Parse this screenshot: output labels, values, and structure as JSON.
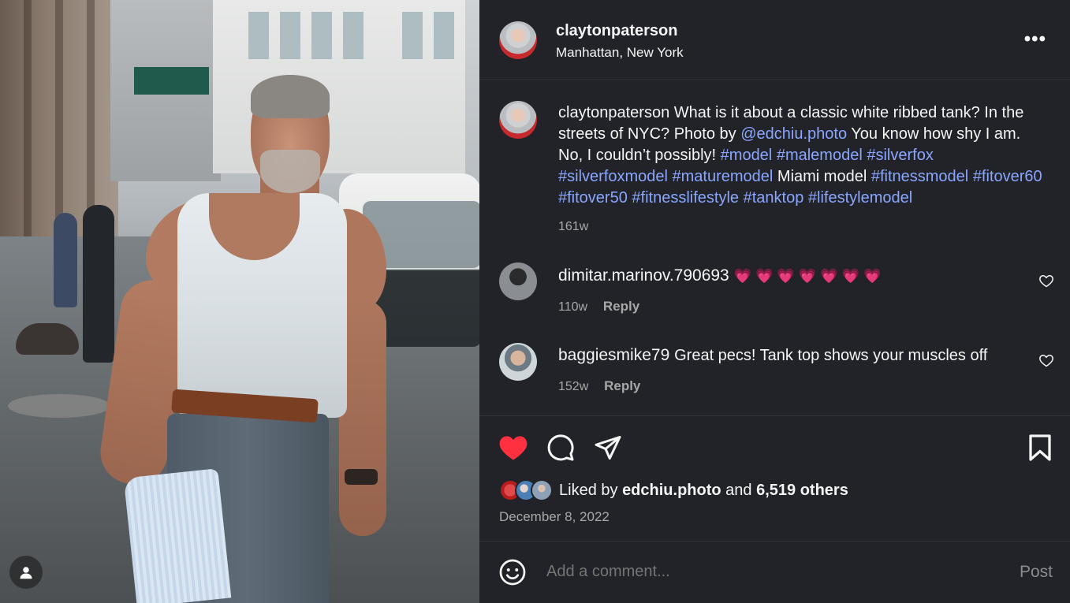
{
  "post": {
    "username": "claytonpaterson",
    "location": "Manhattan, New York",
    "more_label": "•••",
    "caption": {
      "username": "claytonpaterson",
      "text_1": " What is it about a classic white ribbed tank? In the streets of NYC? Photo by ",
      "mention": "@edchiu.photo",
      "text_2": " You know how shy I am. No, I couldn’t possibly! ",
      "tags_1": [
        "#model",
        "#malemodel",
        "#silverfox",
        "#silverfoxmodel",
        "#maturemodel"
      ],
      "text_3": " Miami model ",
      "tags_2": [
        "#fitnessmodel",
        "#fitover60",
        "#fitover50",
        "#fitnesslifestyle",
        "#tanktop",
        "#lifestylemodel"
      ],
      "time": "161w"
    },
    "comments": [
      {
        "username": "dimitar.marinov.790693",
        "text": "💗 💗 💗 💗 💗 💗 💗",
        "time": "110w",
        "reply_label": "Reply"
      },
      {
        "username": "baggiesmike79",
        "text": "Great pecs! Tank top shows your muscles off",
        "time": "152w",
        "reply_label": "Reply"
      }
    ],
    "likes": {
      "prefix": "Liked by",
      "user": "edchiu.photo",
      "and": "and",
      "others": "6,519 others"
    },
    "date": "December 8, 2022",
    "add_comment": {
      "placeholder": "Add a comment...",
      "post_label": "Post"
    }
  },
  "colors": {
    "panel_bg": "#212328",
    "link": "#8aa6ff",
    "like_red": "#ff3040",
    "muted": "#a8a8a8"
  },
  "icons": [
    "more-icon",
    "heart-icon",
    "comment-icon",
    "share-icon",
    "bookmark-icon",
    "emoji-icon",
    "user-icon"
  ]
}
